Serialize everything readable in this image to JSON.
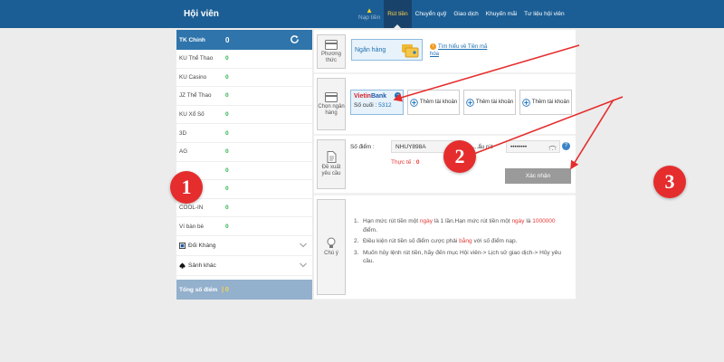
{
  "topbar": {
    "brand": "Hội viên",
    "nav": [
      {
        "label": "Nạp tiền",
        "state": "muted",
        "icon": "warning-icon"
      },
      {
        "label": "Rút tiền",
        "state": "active"
      },
      {
        "label": "Chuyển quỹ",
        "state": "normal"
      },
      {
        "label": "Giao dịch",
        "state": "normal"
      },
      {
        "label": "Khuyến mãi",
        "state": "normal"
      },
      {
        "label": "Tư liệu hội viên",
        "state": "normal"
      }
    ]
  },
  "sidebar": {
    "header": {
      "label": "TK Chính",
      "value": "0",
      "icon": "refresh-icon"
    },
    "rows": [
      {
        "label": "KU Thể Thao",
        "value": "0"
      },
      {
        "label": "KU Casino",
        "value": "0"
      },
      {
        "label": "JZ Thể Thao",
        "value": "0"
      },
      {
        "label": "KU Xổ Số",
        "value": "0"
      },
      {
        "label": "3D",
        "value": "0"
      },
      {
        "label": "AG",
        "value": "0"
      },
      {
        "label": "",
        "value": "0"
      },
      {
        "label": "",
        "value": "0"
      },
      {
        "label": "COOL-IN",
        "value": "0"
      },
      {
        "label": "Ví bàn bè",
        "value": "0"
      }
    ],
    "groups": [
      {
        "label": "Đối Kháng",
        "icon": "cards-icon"
      },
      {
        "label": "Sảnh khác",
        "icon": "spade-icon"
      }
    ],
    "footer": {
      "label": "Tổng số điểm",
      "value": "0"
    }
  },
  "method": {
    "side_label": "Phương thức",
    "bank_button": "Ngân hàng",
    "info_link": "Tìm hiểu về Tiền mã hóa"
  },
  "bank_select": {
    "side_label": "Chọn ngân hàng",
    "selected_bank": {
      "logo_main": "Vietin",
      "logo_accent": "Bank",
      "tail_label": "Số cuối :",
      "tail_value": "5312"
    },
    "add_buttons": [
      "Thêm tài khoản",
      "Thêm tài khoản",
      "Thêm tài khoản"
    ]
  },
  "request": {
    "side_label": "Đề xuất yêu cầu",
    "points_label": "Số điểm :",
    "points_value": "NHUY898A",
    "password_label": "...ẩu rút",
    "password_value": "••••••••",
    "real_label": "Thực tế :",
    "real_value": "0",
    "confirm": "Xác nhận"
  },
  "notes": {
    "side_label": "Chú ý",
    "items": [
      {
        "num": "1.",
        "parts": [
          {
            "text": "Hạn mức rút tiền một ",
            "red": false
          },
          {
            "text": "ngày",
            "red": true
          },
          {
            "text": " là 1 lần.Hạn mức rút tiền một ",
            "red": false
          },
          {
            "text": "ngày",
            "red": true
          },
          {
            "text": " là ",
            "red": false
          },
          {
            "text": "1000000",
            "red": true
          },
          {
            "text": " điểm.",
            "red": false
          }
        ]
      },
      {
        "num": "2.",
        "parts": [
          {
            "text": "Điều kiện rút tiền số điểm cược phải ",
            "red": false
          },
          {
            "text": "bằng",
            "red": true
          },
          {
            "text": " với số điểm nạp.",
            "red": false
          }
        ]
      },
      {
        "num": "3.",
        "parts": [
          {
            "text": "Muốn hủy lệnh rút tiền, hãy đến mục Hội viên-> Lịch sử giao dịch-> Hủy yêu cầu.",
            "red": false
          }
        ]
      }
    ]
  },
  "markers": [
    "1",
    "2",
    "3"
  ],
  "colors": {
    "topbar": "#1b5e95",
    "active_tab": "#19426b",
    "accent_yellow": "#ffd54a",
    "marker": "#e52d2d",
    "positive": "#2bb34a"
  }
}
